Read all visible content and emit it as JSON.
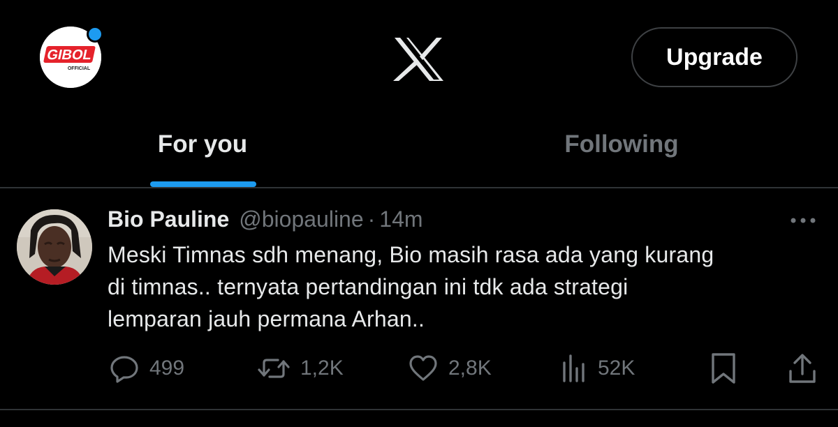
{
  "header": {
    "account_logo_text": "GIBOL",
    "account_logo_subtext": "OFFICIAL",
    "upgrade_label": "Upgrade"
  },
  "tabs": [
    {
      "label": "For you",
      "active": true
    },
    {
      "label": "Following",
      "active": false
    }
  ],
  "tweet": {
    "author_name": "Bio Pauline",
    "author_handle": "@biopauline",
    "separator": "·",
    "time": "14m",
    "text_lines": [
      "Meski Timnas sdh menang, Bio masih rasa ada yang kurang",
      "di timnas.. ternyata pertandingan ini tdk ada strategi",
      "lemparan jauh permana Arhan.."
    ],
    "actions": {
      "replies": "499",
      "reposts": "1,2K",
      "likes": "2,8K",
      "views": "52K"
    }
  },
  "colors": {
    "background": "#000000",
    "text_primary": "#e7e9ea",
    "text_secondary": "#71767b",
    "accent": "#1d9bf0",
    "divider": "#2f3336",
    "brand_red": "#e5222b"
  },
  "icons": {
    "account": "gibol-logo-avatar",
    "notification": "blue-dot",
    "logo": "x-logo",
    "more": "more-dots-icon",
    "reply": "reply-icon",
    "repost": "repost-icon",
    "like": "heart-icon",
    "views": "views-bar-chart-icon",
    "bookmark": "bookmark-icon",
    "share": "share-icon"
  }
}
